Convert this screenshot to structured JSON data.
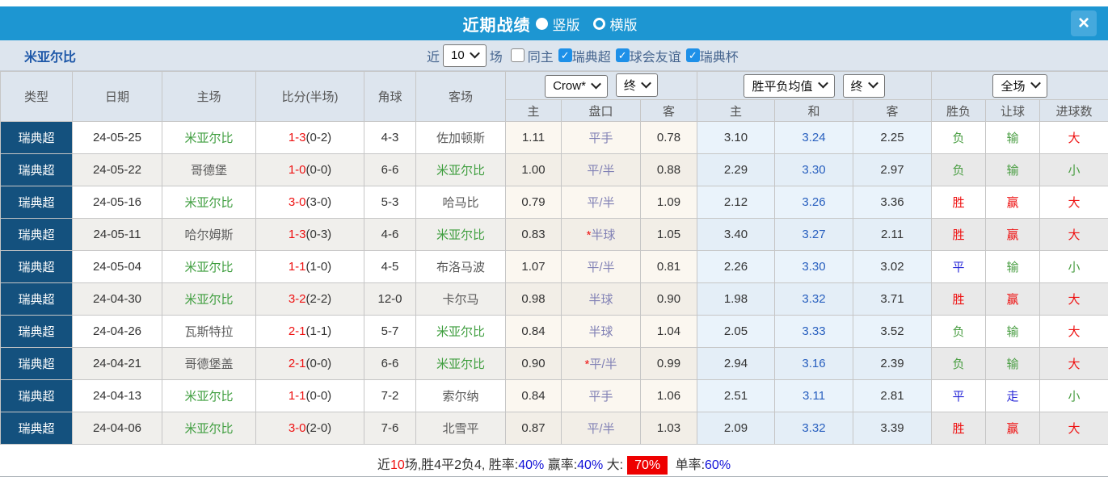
{
  "colors": {
    "accent_blue": "#1d96d2",
    "navy_league": "#14517e",
    "team_green": "#3f9e3f",
    "result_red": "#ee1111",
    "result_green": "#4a9e43",
    "result_blue": "#2a2ad8",
    "draw_value_blue": "#2960bf",
    "handicap_purple": "#8181b5",
    "badge_red": "#ee0000",
    "summary_value_blue": "#1111d8"
  },
  "titlebar": {
    "title": "近期战绩",
    "layout_options": [
      {
        "label": "竖版",
        "selected": true
      },
      {
        "label": "横版",
        "selected": false
      }
    ],
    "close_label": "×"
  },
  "filterbar": {
    "team": "米亚尔比",
    "recent_label": "近",
    "recent_value": "10",
    "matches_label": "场",
    "checkboxes": [
      {
        "label": "同主",
        "checked": false
      },
      {
        "label": "瑞典超",
        "checked": true
      },
      {
        "label": "球会友谊",
        "checked": true
      },
      {
        "label": "瑞典杯",
        "checked": true
      }
    ]
  },
  "table": {
    "static_headers": [
      "类型",
      "日期",
      "主场",
      "比分(半场)",
      "角球",
      "客场"
    ],
    "groups": [
      {
        "dropdowns": [
          "Crow*",
          "终"
        ],
        "subcols": [
          "主",
          "盘口",
          "客"
        ]
      },
      {
        "dropdowns": [
          "胜平负均值",
          "终"
        ],
        "subcols": [
          "主",
          "和",
          "客"
        ]
      },
      {
        "dropdowns": [
          "全场"
        ],
        "subcols": [
          "胜负",
          "让球",
          "进球数"
        ]
      }
    ],
    "rows": [
      {
        "league": "瑞典超",
        "date": "24-05-25",
        "home": {
          "text": "米亚尔比",
          "hl": true
        },
        "score": "1-3",
        "half": "(0-2)",
        "corners": "4-3",
        "away": {
          "text": "佐加顿斯",
          "hl": false
        },
        "crown": {
          "home": "1.11",
          "handicap": "平手",
          "star": false,
          "away": "0.78"
        },
        "avg": {
          "home": "3.10",
          "draw": "3.24",
          "away": "2.25"
        },
        "full": {
          "result": {
            "text": "负",
            "color": "green"
          },
          "handicap": {
            "text": "输",
            "color": "green"
          },
          "goals": {
            "text": "大",
            "color": "red"
          }
        }
      },
      {
        "league": "瑞典超",
        "date": "24-05-22",
        "home": {
          "text": "哥德堡",
          "hl": false
        },
        "score": "1-0",
        "half": "(0-0)",
        "corners": "6-6",
        "away": {
          "text": "米亚尔比",
          "hl": true
        },
        "crown": {
          "home": "1.00",
          "handicap": "平/半",
          "star": false,
          "away": "0.88"
        },
        "avg": {
          "home": "2.29",
          "draw": "3.30",
          "away": "2.97"
        },
        "full": {
          "result": {
            "text": "负",
            "color": "green"
          },
          "handicap": {
            "text": "输",
            "color": "green"
          },
          "goals": {
            "text": "小",
            "color": "green"
          }
        }
      },
      {
        "league": "瑞典超",
        "date": "24-05-16",
        "home": {
          "text": "米亚尔比",
          "hl": true
        },
        "score": "3-0",
        "half": "(3-0)",
        "corners": "5-3",
        "away": {
          "text": "哈马比",
          "hl": false
        },
        "crown": {
          "home": "0.79",
          "handicap": "平/半",
          "star": false,
          "away": "1.09"
        },
        "avg": {
          "home": "2.12",
          "draw": "3.26",
          "away": "3.36"
        },
        "full": {
          "result": {
            "text": "胜",
            "color": "red"
          },
          "handicap": {
            "text": "赢",
            "color": "red"
          },
          "goals": {
            "text": "大",
            "color": "red"
          }
        }
      },
      {
        "league": "瑞典超",
        "date": "24-05-11",
        "home": {
          "text": "哈尔姆斯",
          "hl": false
        },
        "score": "1-3",
        "half": "(0-3)",
        "corners": "4-6",
        "away": {
          "text": "米亚尔比",
          "hl": true
        },
        "crown": {
          "home": "0.83",
          "handicap": "半球",
          "star": true,
          "away": "1.05"
        },
        "avg": {
          "home": "3.40",
          "draw": "3.27",
          "away": "2.11"
        },
        "full": {
          "result": {
            "text": "胜",
            "color": "red"
          },
          "handicap": {
            "text": "赢",
            "color": "red"
          },
          "goals": {
            "text": "大",
            "color": "red"
          }
        }
      },
      {
        "league": "瑞典超",
        "date": "24-05-04",
        "home": {
          "text": "米亚尔比",
          "hl": true
        },
        "score": "1-1",
        "half": "(1-0)",
        "corners": "4-5",
        "away": {
          "text": "布洛马波",
          "hl": false
        },
        "crown": {
          "home": "1.07",
          "handicap": "平/半",
          "star": false,
          "away": "0.81"
        },
        "avg": {
          "home": "2.26",
          "draw": "3.30",
          "away": "3.02"
        },
        "full": {
          "result": {
            "text": "平",
            "color": "blue"
          },
          "handicap": {
            "text": "输",
            "color": "green"
          },
          "goals": {
            "text": "小",
            "color": "green"
          }
        }
      },
      {
        "league": "瑞典超",
        "date": "24-04-30",
        "home": {
          "text": "米亚尔比",
          "hl": true
        },
        "score": "3-2",
        "half": "(2-2)",
        "corners": "12-0",
        "away": {
          "text": "卡尔马",
          "hl": false
        },
        "crown": {
          "home": "0.98",
          "handicap": "半球",
          "star": false,
          "away": "0.90"
        },
        "avg": {
          "home": "1.98",
          "draw": "3.32",
          "away": "3.71"
        },
        "full": {
          "result": {
            "text": "胜",
            "color": "red"
          },
          "handicap": {
            "text": "赢",
            "color": "red"
          },
          "goals": {
            "text": "大",
            "color": "red"
          }
        }
      },
      {
        "league": "瑞典超",
        "date": "24-04-26",
        "home": {
          "text": "瓦斯特拉",
          "hl": false
        },
        "score": "2-1",
        "half": "(1-1)",
        "corners": "5-7",
        "away": {
          "text": "米亚尔比",
          "hl": true
        },
        "crown": {
          "home": "0.84",
          "handicap": "半球",
          "star": false,
          "away": "1.04"
        },
        "avg": {
          "home": "2.05",
          "draw": "3.33",
          "away": "3.52"
        },
        "full": {
          "result": {
            "text": "负",
            "color": "green"
          },
          "handicap": {
            "text": "输",
            "color": "green"
          },
          "goals": {
            "text": "大",
            "color": "red"
          }
        }
      },
      {
        "league": "瑞典超",
        "date": "24-04-21",
        "home": {
          "text": "哥德堡盖",
          "hl": false
        },
        "score": "2-1",
        "half": "(0-0)",
        "corners": "6-6",
        "away": {
          "text": "米亚尔比",
          "hl": true
        },
        "crown": {
          "home": "0.90",
          "handicap": "平/半",
          "star": true,
          "away": "0.99"
        },
        "avg": {
          "home": "2.94",
          "draw": "3.16",
          "away": "2.39"
        },
        "full": {
          "result": {
            "text": "负",
            "color": "green"
          },
          "handicap": {
            "text": "输",
            "color": "green"
          },
          "goals": {
            "text": "大",
            "color": "red"
          }
        }
      },
      {
        "league": "瑞典超",
        "date": "24-04-13",
        "home": {
          "text": "米亚尔比",
          "hl": true
        },
        "score": "1-1",
        "half": "(0-0)",
        "corners": "7-2",
        "away": {
          "text": "索尔纳",
          "hl": false
        },
        "crown": {
          "home": "0.84",
          "handicap": "平手",
          "star": false,
          "away": "1.06"
        },
        "avg": {
          "home": "2.51",
          "draw": "3.11",
          "away": "2.81"
        },
        "full": {
          "result": {
            "text": "平",
            "color": "blue"
          },
          "handicap": {
            "text": "走",
            "color": "blue"
          },
          "goals": {
            "text": "小",
            "color": "green"
          }
        }
      },
      {
        "league": "瑞典超",
        "date": "24-04-06",
        "home": {
          "text": "米亚尔比",
          "hl": true
        },
        "score": "3-0",
        "half": "(2-0)",
        "corners": "7-6",
        "away": {
          "text": "北雪平",
          "hl": false
        },
        "crown": {
          "home": "0.87",
          "handicap": "平/半",
          "star": false,
          "away": "1.03"
        },
        "avg": {
          "home": "2.09",
          "draw": "3.32",
          "away": "3.39"
        },
        "full": {
          "result": {
            "text": "胜",
            "color": "red"
          },
          "handicap": {
            "text": "赢",
            "color": "red"
          },
          "goals": {
            "text": "大",
            "color": "red"
          }
        }
      }
    ]
  },
  "summary": {
    "segments": [
      {
        "text": "近",
        "style": "dark"
      },
      {
        "text": "10",
        "style": "red"
      },
      {
        "text": "场,胜4平2负4, 胜率:",
        "style": "dark"
      },
      {
        "text": "40%",
        "style": "blue"
      },
      {
        "text": " 赢率:",
        "style": "dark"
      },
      {
        "text": "40%",
        "style": "blue"
      },
      {
        "text": " 大:",
        "style": "dark"
      },
      {
        "text": "70%",
        "style": "red-badge"
      },
      {
        "text": " 单率:",
        "style": "dark"
      },
      {
        "text": "60%",
        "style": "blue"
      }
    ]
  }
}
